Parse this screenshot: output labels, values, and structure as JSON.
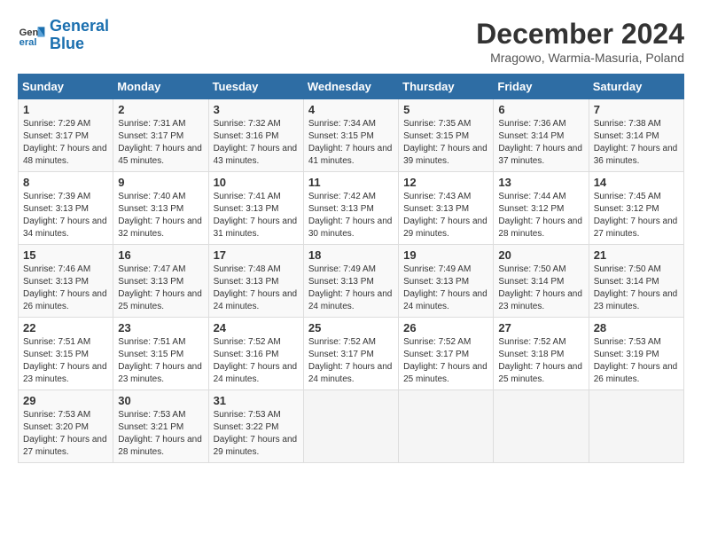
{
  "header": {
    "logo_line1": "General",
    "logo_line2": "Blue",
    "title": "December 2024",
    "subtitle": "Mragowo, Warmia-Masuria, Poland"
  },
  "days_of_week": [
    "Sunday",
    "Monday",
    "Tuesday",
    "Wednesday",
    "Thursday",
    "Friday",
    "Saturday"
  ],
  "weeks": [
    [
      {
        "day": "1",
        "sunrise": "7:29 AM",
        "sunset": "3:17 PM",
        "daylight": "7 hours and 48 minutes."
      },
      {
        "day": "2",
        "sunrise": "7:31 AM",
        "sunset": "3:17 PM",
        "daylight": "7 hours and 45 minutes."
      },
      {
        "day": "3",
        "sunrise": "7:32 AM",
        "sunset": "3:16 PM",
        "daylight": "7 hours and 43 minutes."
      },
      {
        "day": "4",
        "sunrise": "7:34 AM",
        "sunset": "3:15 PM",
        "daylight": "7 hours and 41 minutes."
      },
      {
        "day": "5",
        "sunrise": "7:35 AM",
        "sunset": "3:15 PM",
        "daylight": "7 hours and 39 minutes."
      },
      {
        "day": "6",
        "sunrise": "7:36 AM",
        "sunset": "3:14 PM",
        "daylight": "7 hours and 37 minutes."
      },
      {
        "day": "7",
        "sunrise": "7:38 AM",
        "sunset": "3:14 PM",
        "daylight": "7 hours and 36 minutes."
      }
    ],
    [
      {
        "day": "8",
        "sunrise": "7:39 AM",
        "sunset": "3:13 PM",
        "daylight": "7 hours and 34 minutes."
      },
      {
        "day": "9",
        "sunrise": "7:40 AM",
        "sunset": "3:13 PM",
        "daylight": "7 hours and 32 minutes."
      },
      {
        "day": "10",
        "sunrise": "7:41 AM",
        "sunset": "3:13 PM",
        "daylight": "7 hours and 31 minutes."
      },
      {
        "day": "11",
        "sunrise": "7:42 AM",
        "sunset": "3:13 PM",
        "daylight": "7 hours and 30 minutes."
      },
      {
        "day": "12",
        "sunrise": "7:43 AM",
        "sunset": "3:13 PM",
        "daylight": "7 hours and 29 minutes."
      },
      {
        "day": "13",
        "sunrise": "7:44 AM",
        "sunset": "3:12 PM",
        "daylight": "7 hours and 28 minutes."
      },
      {
        "day": "14",
        "sunrise": "7:45 AM",
        "sunset": "3:12 PM",
        "daylight": "7 hours and 27 minutes."
      }
    ],
    [
      {
        "day": "15",
        "sunrise": "7:46 AM",
        "sunset": "3:13 PM",
        "daylight": "7 hours and 26 minutes."
      },
      {
        "day": "16",
        "sunrise": "7:47 AM",
        "sunset": "3:13 PM",
        "daylight": "7 hours and 25 minutes."
      },
      {
        "day": "17",
        "sunrise": "7:48 AM",
        "sunset": "3:13 PM",
        "daylight": "7 hours and 24 minutes."
      },
      {
        "day": "18",
        "sunrise": "7:49 AM",
        "sunset": "3:13 PM",
        "daylight": "7 hours and 24 minutes."
      },
      {
        "day": "19",
        "sunrise": "7:49 AM",
        "sunset": "3:13 PM",
        "daylight": "7 hours and 24 minutes."
      },
      {
        "day": "20",
        "sunrise": "7:50 AM",
        "sunset": "3:14 PM",
        "daylight": "7 hours and 23 minutes."
      },
      {
        "day": "21",
        "sunrise": "7:50 AM",
        "sunset": "3:14 PM",
        "daylight": "7 hours and 23 minutes."
      }
    ],
    [
      {
        "day": "22",
        "sunrise": "7:51 AM",
        "sunset": "3:15 PM",
        "daylight": "7 hours and 23 minutes."
      },
      {
        "day": "23",
        "sunrise": "7:51 AM",
        "sunset": "3:15 PM",
        "daylight": "7 hours and 23 minutes."
      },
      {
        "day": "24",
        "sunrise": "7:52 AM",
        "sunset": "3:16 PM",
        "daylight": "7 hours and 24 minutes."
      },
      {
        "day": "25",
        "sunrise": "7:52 AM",
        "sunset": "3:17 PM",
        "daylight": "7 hours and 24 minutes."
      },
      {
        "day": "26",
        "sunrise": "7:52 AM",
        "sunset": "3:17 PM",
        "daylight": "7 hours and 25 minutes."
      },
      {
        "day": "27",
        "sunrise": "7:52 AM",
        "sunset": "3:18 PM",
        "daylight": "7 hours and 25 minutes."
      },
      {
        "day": "28",
        "sunrise": "7:53 AM",
        "sunset": "3:19 PM",
        "daylight": "7 hours and 26 minutes."
      }
    ],
    [
      {
        "day": "29",
        "sunrise": "7:53 AM",
        "sunset": "3:20 PM",
        "daylight": "7 hours and 27 minutes."
      },
      {
        "day": "30",
        "sunrise": "7:53 AM",
        "sunset": "3:21 PM",
        "daylight": "7 hours and 28 minutes."
      },
      {
        "day": "31",
        "sunrise": "7:53 AM",
        "sunset": "3:22 PM",
        "daylight": "7 hours and 29 minutes."
      },
      null,
      null,
      null,
      null
    ]
  ]
}
